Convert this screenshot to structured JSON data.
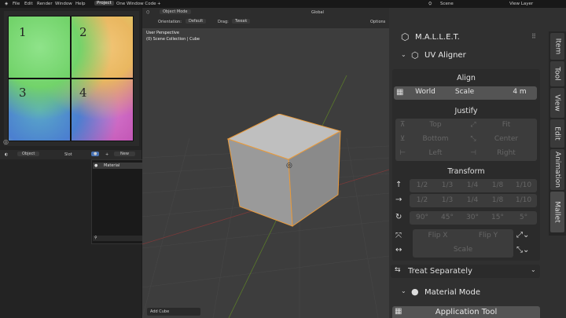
{
  "topbar": {
    "menus": [
      "File",
      "Edit",
      "Render",
      "Window",
      "Help"
    ],
    "tabs": [
      "Project",
      "One Window Code"
    ],
    "add": "+",
    "scene": "Scene",
    "view_layer": "View Layer"
  },
  "uv": {
    "quads": [
      "1",
      "2",
      "3",
      "4"
    ]
  },
  "left_header": {
    "object": "Object",
    "slot": "Slot",
    "new": "New",
    "material": "Material"
  },
  "viewport": {
    "mode": "Object Mode",
    "orientation_label": "Orientation:",
    "orientation": "Default",
    "drag_label": "Drag:",
    "drag": "Tweak",
    "global": "Global",
    "options": "Options",
    "perspective": "User Perspective",
    "collection": "(0) Scene Collection | Cube",
    "add_cube": "Add Cube"
  },
  "panel": {
    "title": "M.A.L.L.E.T.",
    "uv_aligner": "UV Aligner",
    "align": "Align",
    "world": "World",
    "scale": "Scale",
    "scale_value": "4 m",
    "justify": "Justify",
    "justify_buttons": [
      "Top",
      "Fit",
      "Bottom",
      "Center",
      "Left",
      "Right"
    ],
    "transform": "Transform",
    "fractions": [
      "1/2",
      "1/3",
      "1/4",
      "1/8",
      "1/10"
    ],
    "angles": [
      "90°",
      "45°",
      "30°",
      "15°",
      "5°"
    ],
    "flip_x": "Flip X",
    "flip_y": "Flip Y",
    "scale2": "Scale",
    "treat": "Treat Separately",
    "material_mode": "Material Mode",
    "application_tool": "Application Tool"
  },
  "sidetabs": [
    "Item",
    "Tool",
    "View",
    "Edit",
    "Animation",
    "Mallet"
  ]
}
